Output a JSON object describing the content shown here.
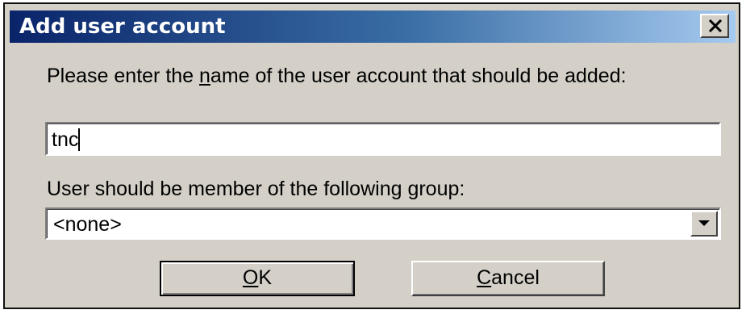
{
  "window": {
    "title": "Add user account",
    "close_icon": "close-icon"
  },
  "prompt": {
    "before_mnemonic": "Please enter the ",
    "mnemonic": "n",
    "after_mnemonic": "ame of the user account that should be added:"
  },
  "username_input": {
    "value": "tnc"
  },
  "group": {
    "label_before_mnemonic": "User should be member of the following ",
    "label_mnemonic": "g",
    "label_after_mnemonic": "roup:",
    "selected_value": "<none>",
    "arrow_icon": "chevron-down-icon"
  },
  "buttons": {
    "ok_mnemonic": "O",
    "ok_rest": "K",
    "cancel_mnemonic": "C",
    "cancel_rest": "ancel"
  },
  "colors": {
    "dialog_face": "#d4d0c8",
    "titlebar_start": "#0a246a",
    "titlebar_end": "#a6caf0"
  }
}
